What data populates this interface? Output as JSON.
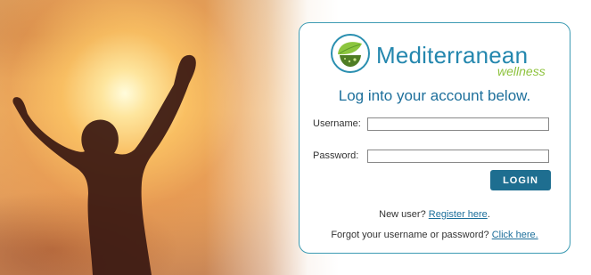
{
  "brand": {
    "name": "Mediterranean",
    "tagline": "wellness",
    "accent_blue": "#2487ae",
    "accent_green": "#8fc33f"
  },
  "form": {
    "heading": "Log into your account below.",
    "username_label": "Username:",
    "username_value": "",
    "password_label": "Password:",
    "password_value": "",
    "login_label": "LOGIN"
  },
  "links": {
    "new_user_text": "New user?",
    "register_link": "Register here",
    "register_suffix": ".",
    "forgot_text": "Forgot your username or password?",
    "click_here_link": "Click here."
  },
  "hero": {
    "image": "silhouette-raised-arms-sunset"
  }
}
